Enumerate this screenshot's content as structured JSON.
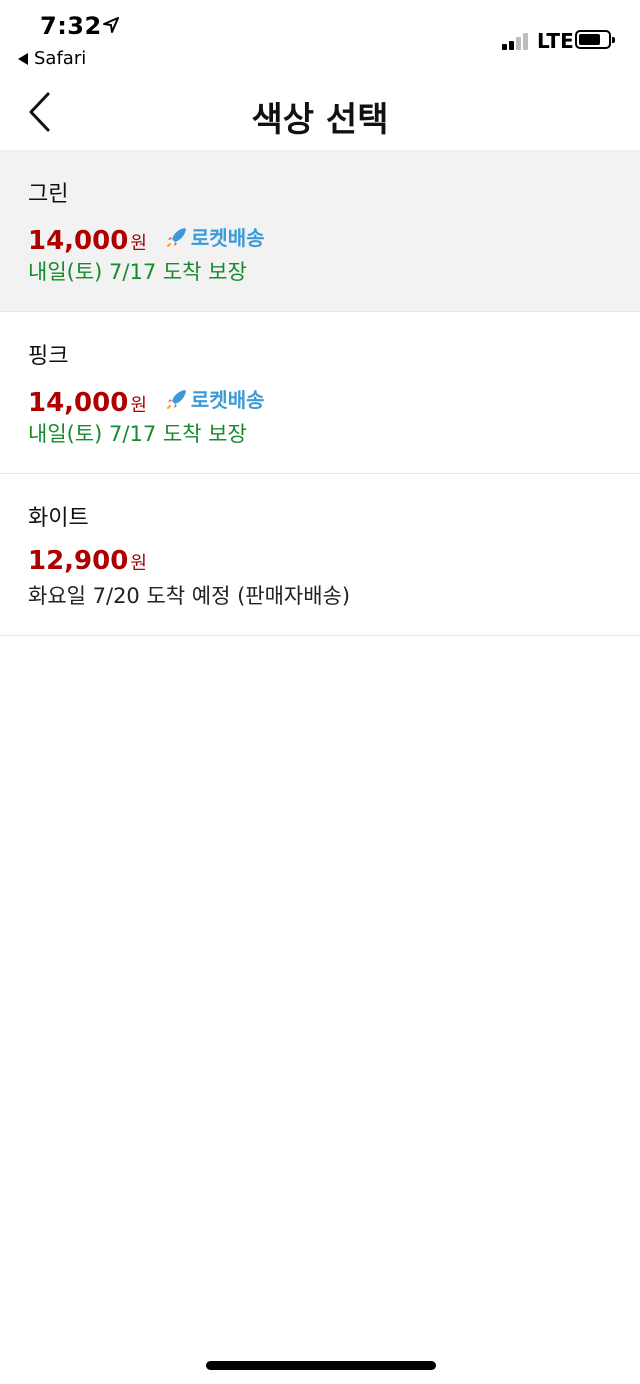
{
  "status_bar": {
    "time": "7:32",
    "back_app": "Safari",
    "network": "LTE",
    "icons": [
      "location-arrow-icon",
      "signal-icon",
      "battery-icon"
    ]
  },
  "header": {
    "title": "색상 선택",
    "back_icon": "chevron-left-icon"
  },
  "colors": {
    "price": "#ae0000",
    "rocket_delivery": "#178a2e",
    "rocket_badge": "#3a9bd8",
    "selected_bg": "#f2f2f2"
  },
  "options": [
    {
      "name": "그린",
      "price": "14,000",
      "currency": "원",
      "badge": "로켓배송",
      "delivery": "내일(토) 7/17 도착 보장",
      "selected": true
    },
    {
      "name": "핑크",
      "price": "14,000",
      "currency": "원",
      "badge": "로켓배송",
      "delivery": "내일(토) 7/17 도착 보장",
      "selected": false
    },
    {
      "name": "화이트",
      "price": "12,900",
      "currency": "원",
      "badge": "",
      "delivery": "화요일 7/20 도착 예정 (판매자배송)",
      "selected": false
    }
  ]
}
